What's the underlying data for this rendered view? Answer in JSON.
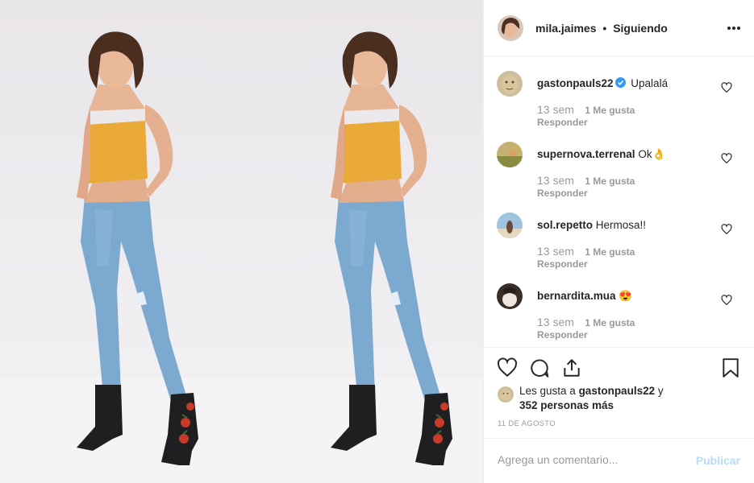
{
  "post": {
    "author": "mila.jaimes",
    "separator": "•",
    "follow_state": "Siguiendo",
    "more_icon": "more-options-icon"
  },
  "comments": [
    {
      "user": "gastonpauls22",
      "verified": true,
      "text": "Upalalá",
      "time": "13 sem",
      "likes": "1 Me gusta",
      "reply": "Responder"
    },
    {
      "user": "supernova.terrenal",
      "verified": false,
      "text": "Ok👌",
      "time": "13 sem",
      "likes": "1 Me gusta",
      "reply": "Responder"
    },
    {
      "user": "sol.repetto",
      "verified": false,
      "text": "Hermosa!!",
      "time": "13 sem",
      "likes": "1 Me gusta",
      "reply": "Responder"
    },
    {
      "user": "bernardita.mua",
      "verified": false,
      "text": "😍",
      "time": "13 sem",
      "likes": "1 Me gusta",
      "reply": "Responder"
    }
  ],
  "likes": {
    "prefix": "Les gusta a ",
    "user": "gastonpauls22",
    "suffix": " y",
    "others": "352 personas más"
  },
  "date": "11 DE AGOSTO",
  "comment_box": {
    "placeholder": "Agrega un comentario...",
    "publish_label": "Publicar"
  },
  "colors": {
    "text": "#262626",
    "muted": "#999999",
    "border": "#efefef",
    "publish_disabled": "#b9dbf7",
    "verified": "#3897f0"
  }
}
